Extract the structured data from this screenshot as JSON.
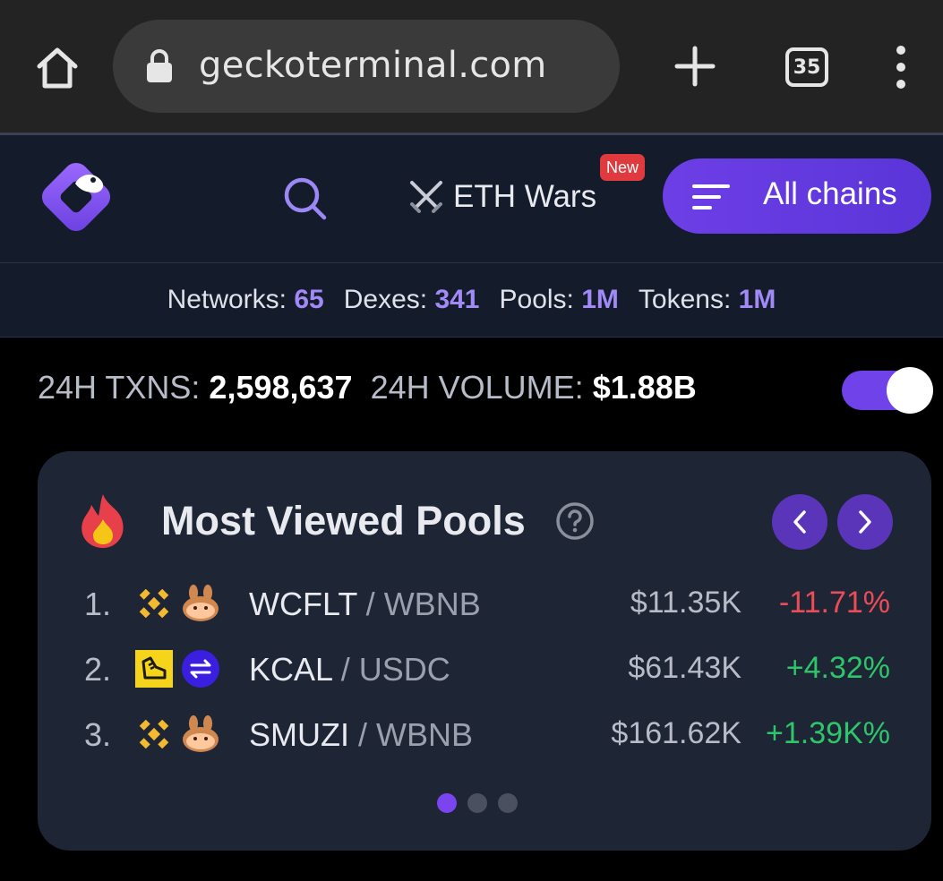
{
  "browser": {
    "url": "geckoterminal.com",
    "tab_count": "35"
  },
  "header": {
    "ethwars_label": "ETH Wars",
    "new_badge": "New",
    "chains_label": "All chains"
  },
  "stats": {
    "networks_label": "Networks:",
    "networks_value": "65",
    "dexes_label": "Dexes:",
    "dexes_value": "341",
    "pools_label": "Pools:",
    "pools_value": "1M",
    "tokens_label": "Tokens:",
    "tokens_value": "1M"
  },
  "totals": {
    "txns_label": "24H TXNS:",
    "txns_value": "2,598,637",
    "volume_label": "24H VOLUME:",
    "volume_value": "$1.88B",
    "toggle_on": true
  },
  "most_viewed": {
    "title": "Most Viewed Pools",
    "pools": [
      {
        "rank": "1.",
        "base": "WCFLT",
        "sep": "/",
        "quote": "WBNB",
        "price": "$11.35K",
        "change": "-11.71%",
        "direction": "neg",
        "icons": [
          "bnb-icon",
          "pancakeswap-icon"
        ]
      },
      {
        "rank": "2.",
        "base": "KCAL",
        "sep": "/",
        "quote": "USDC",
        "price": "$61.43K",
        "change": "+4.32%",
        "direction": "pos",
        "icons": [
          "stepn-icon",
          "swap-dex-icon"
        ]
      },
      {
        "rank": "3.",
        "base": "SMUZI",
        "sep": "/",
        "quote": "WBNB",
        "price": "$161.62K",
        "change": "+1.39K%",
        "direction": "pos",
        "icons": [
          "bnb-icon",
          "pancakeswap-icon"
        ]
      }
    ],
    "pages": 3,
    "active_page": 1
  },
  "colors": {
    "accent": "#6d3fe6",
    "positive": "#2fc56a",
    "negative": "#ea4d57",
    "stat_value": "#a189f6"
  }
}
